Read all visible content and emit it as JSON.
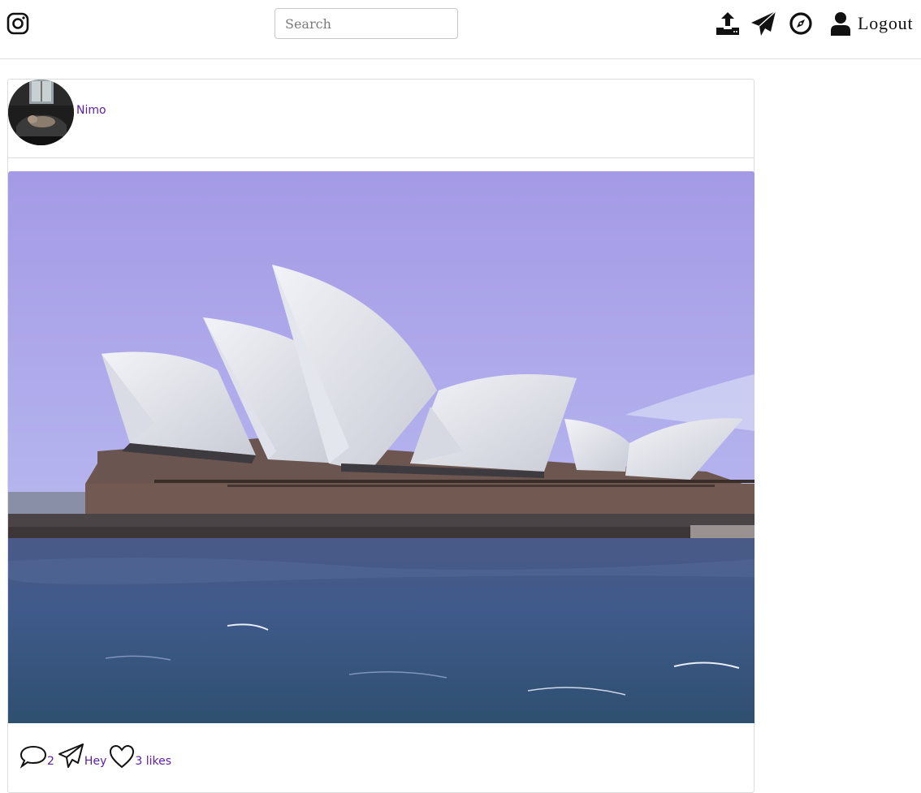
{
  "header": {
    "logo_icon": "instagram-icon",
    "search": {
      "placeholder": "Search",
      "value": ""
    },
    "icons": [
      "upload-icon",
      "send-icon",
      "explore-icon",
      "user-icon"
    ],
    "logout_label": "Logout"
  },
  "post": {
    "username": "Nimo",
    "avatar_icon": "avatar",
    "comment_count": "2",
    "share_label": "Hey",
    "likes_label": "3 likes"
  },
  "colors": {
    "link": "#5b1ea8",
    "border": "#dcdcdc",
    "icon": "#111111"
  }
}
